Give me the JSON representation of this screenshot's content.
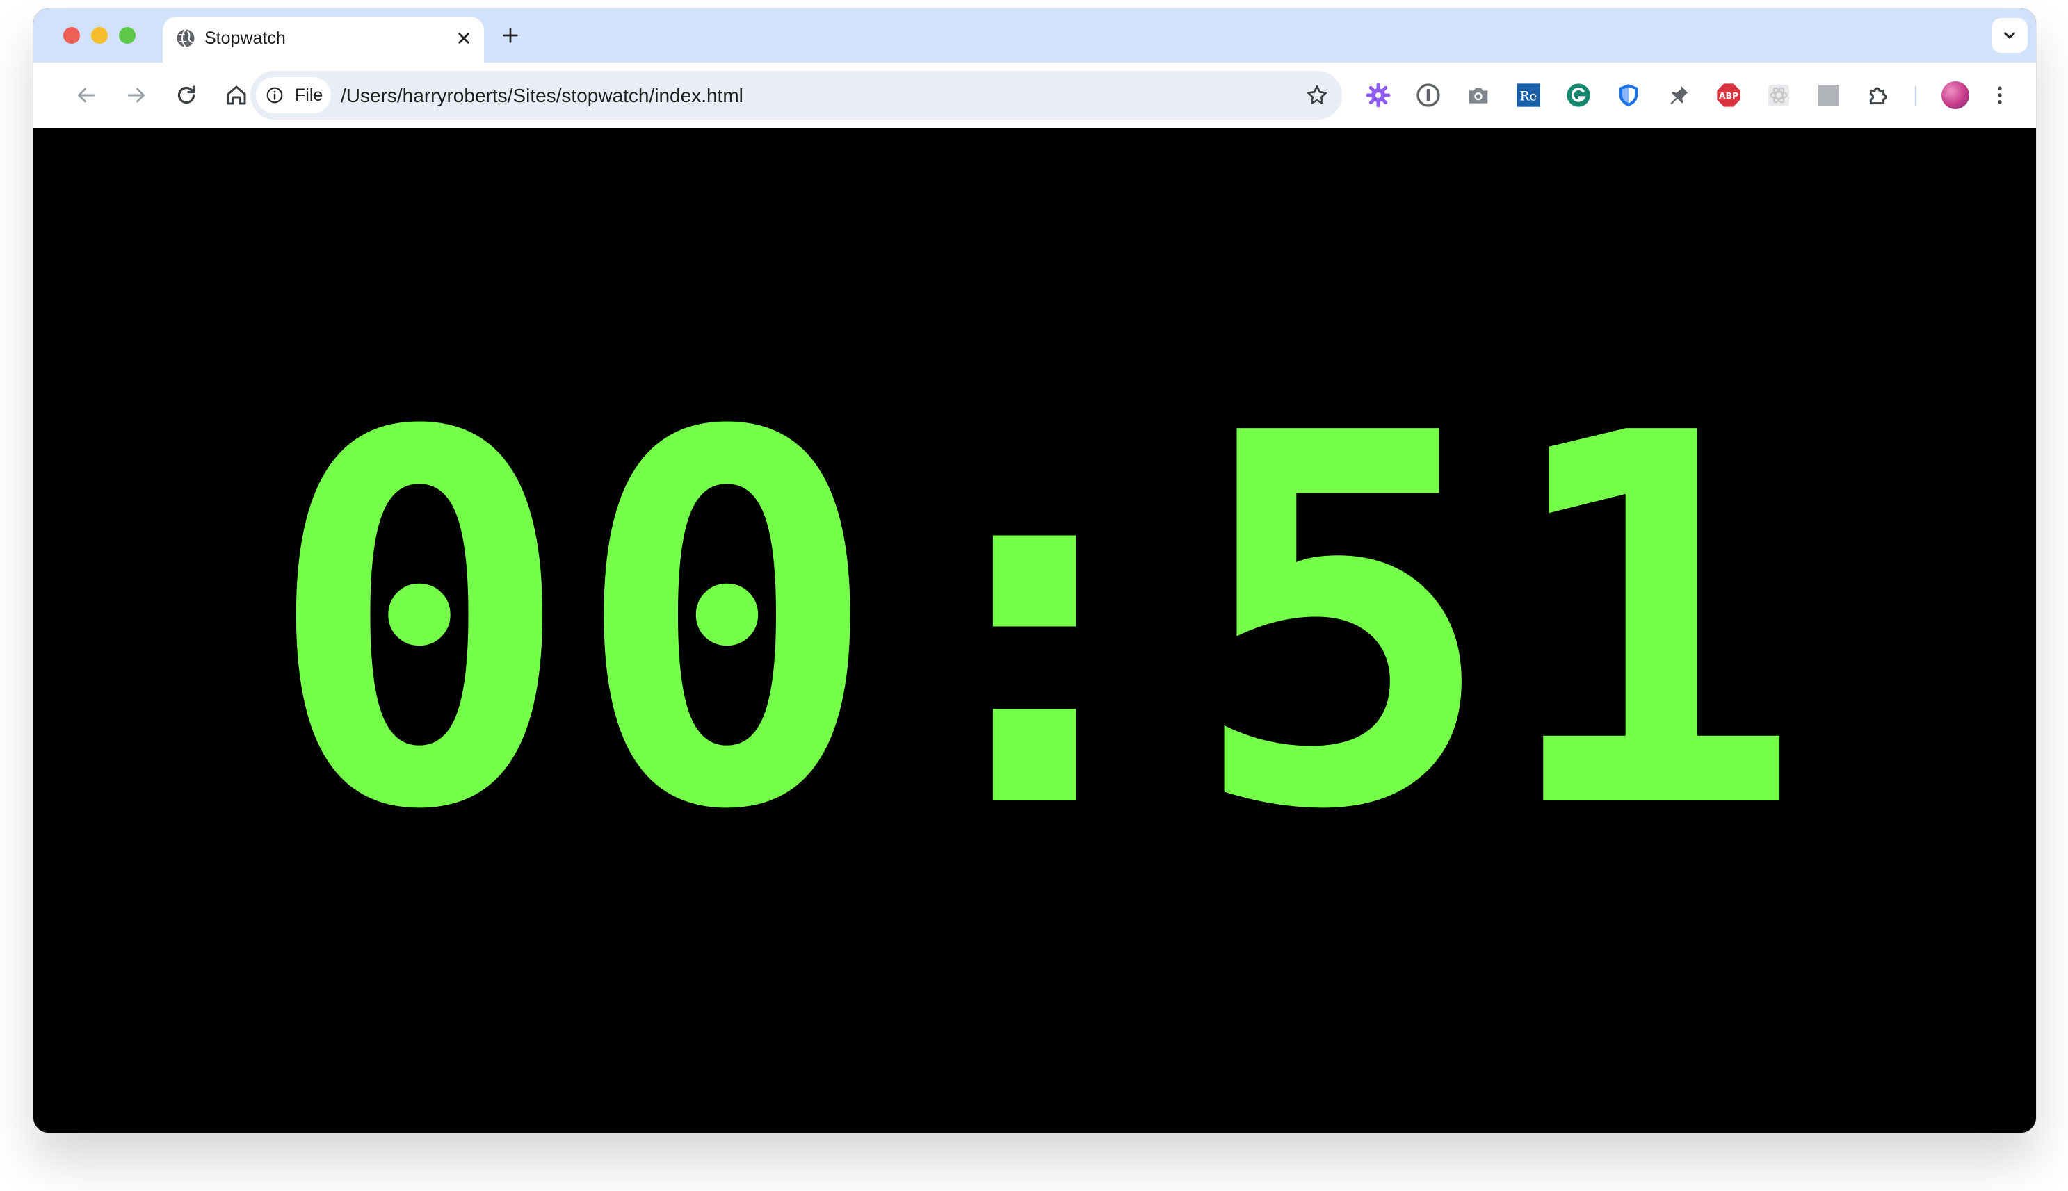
{
  "browser": {
    "tab": {
      "title": "Stopwatch"
    },
    "omnibox": {
      "scheme_chip": "File",
      "url": "/Users/harryroberts/Sites/stopwatch/index.html"
    },
    "extensions": [
      {
        "icon": "gear-extension-icon",
        "color": "#8e5cf0"
      },
      {
        "icon": "1password-icon",
        "color": "#5f6368"
      },
      {
        "icon": "camera-icon",
        "color": "#80868b"
      },
      {
        "icon": "re-extension-icon",
        "color": "#1a5ea8",
        "label": "Re"
      },
      {
        "icon": "grammarly-icon",
        "color": "#15876e"
      },
      {
        "icon": "shield-extension-icon",
        "color": "#1a73e8"
      },
      {
        "icon": "pin-extension-icon",
        "color": "#5f6368"
      },
      {
        "icon": "adblock-plus-icon",
        "color": "#d9333f",
        "label": "ABP"
      },
      {
        "icon": "react-devtools-icon",
        "color": "#c4c7c5"
      },
      {
        "icon": "grey-square-extension-icon",
        "color": "#b0b3b8"
      },
      {
        "icon": "puzzle-icon",
        "color": "#3c4043"
      }
    ]
  },
  "page": {
    "stopwatch": {
      "display": "00:51",
      "color": "#76ff4a",
      "background": "#000000"
    }
  }
}
